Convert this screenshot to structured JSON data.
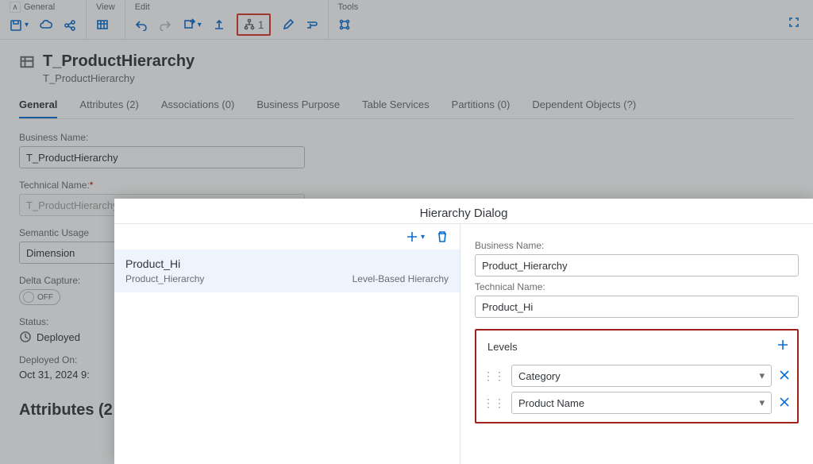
{
  "toolbar": {
    "groups": {
      "general": "General",
      "view": "View",
      "edit": "Edit",
      "tools": "Tools"
    },
    "hierarchy_count": "1"
  },
  "entity": {
    "title": "T_ProductHierarchy",
    "subtitle": "T_ProductHierarchy"
  },
  "tabs": [
    {
      "label": "General"
    },
    {
      "label": "Attributes (2)"
    },
    {
      "label": "Associations (0)"
    },
    {
      "label": "Business Purpose"
    },
    {
      "label": "Table Services"
    },
    {
      "label": "Partitions (0)"
    },
    {
      "label": "Dependent Objects (?)"
    }
  ],
  "form": {
    "business_name_label": "Business Name:",
    "business_name_value": "T_ProductHierarchy",
    "technical_name_label": "Technical Name:",
    "technical_name_required": "*",
    "technical_name_value": "T_ProductHierarchy",
    "semantic_label": "Semantic Usage",
    "semantic_value": "Dimension",
    "delta_label": "Delta Capture:",
    "delta_value": "OFF",
    "status_label": "Status:",
    "status_value": "Deployed",
    "deployed_label": "Deployed On:",
    "deployed_value": "Oct 31, 2024 9:"
  },
  "section_attributes": "Attributes (2",
  "dialog": {
    "title": "Hierarchy Dialog",
    "left": {
      "item_name": "Product_Hi",
      "item_secondary": "Product_Hierarchy",
      "item_type": "Level-Based Hierarchy"
    },
    "right": {
      "business_name_label": "Business Name:",
      "business_name_value": "Product_Hierarchy",
      "technical_name_label": "Technical Name:",
      "technical_name_value": "Product_Hi",
      "levels_title": "Levels",
      "levels": [
        {
          "value": "Category"
        },
        {
          "value": "Product Name"
        }
      ]
    }
  }
}
